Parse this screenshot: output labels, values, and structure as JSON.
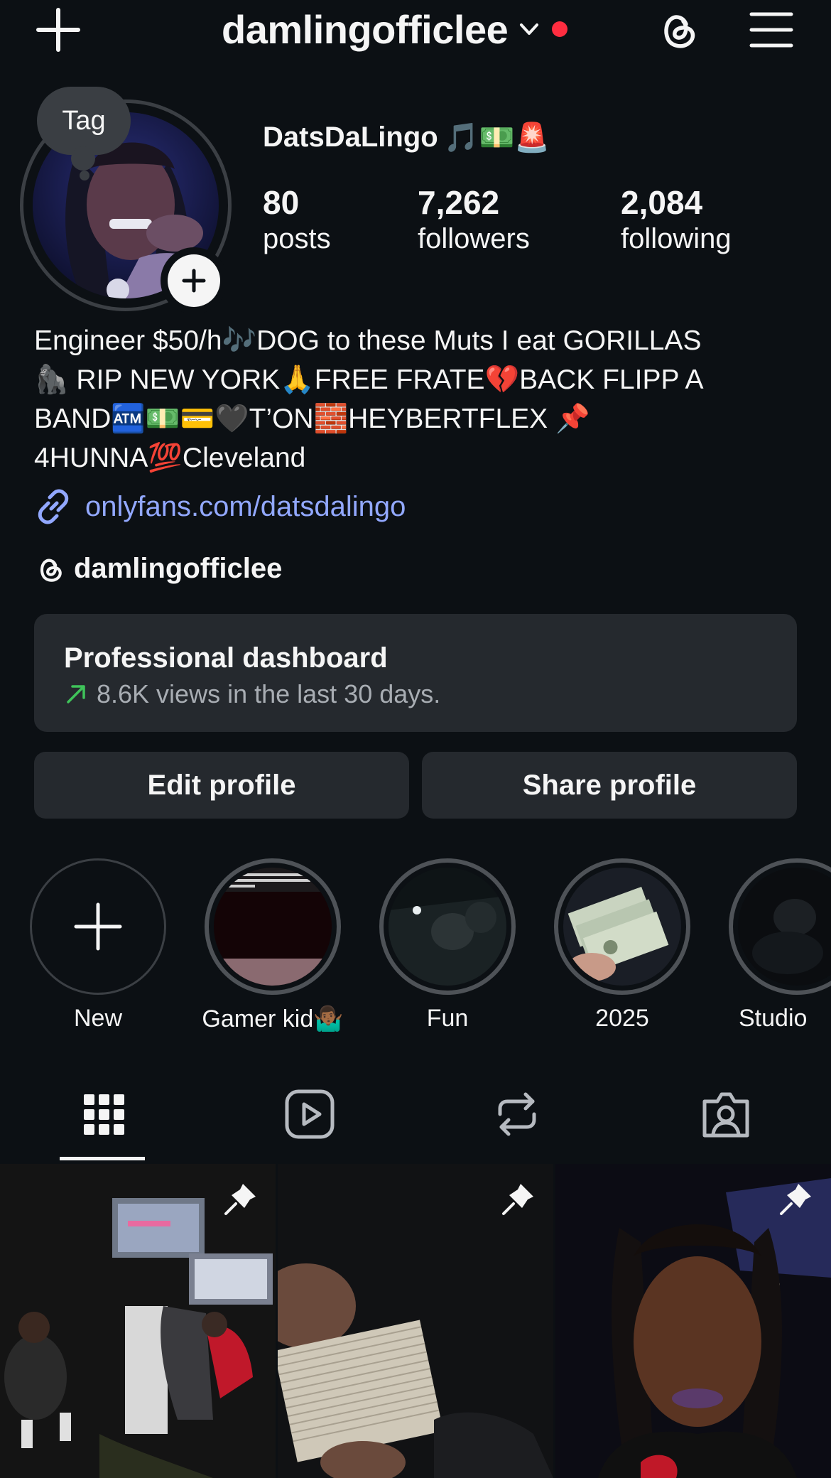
{
  "header": {
    "username": "damlingofficlee",
    "icons": [
      "plus-icon",
      "chevron-down-icon",
      "notification-dot",
      "threads-icon",
      "menu-icon"
    ]
  },
  "profile": {
    "tag_label": "Tag",
    "display_name": "DatsDaLingo",
    "display_name_emojis": "🎵💵🚨",
    "stats": [
      {
        "value": "80",
        "label": "posts"
      },
      {
        "value": "7,262",
        "label": "followers"
      },
      {
        "value": "2,084",
        "label": "following"
      }
    ]
  },
  "bio": {
    "text": "Engineer $50/h🎶DOG to these Muts I eat GORILLAS\n🦍 RIP NEW YORK🙏FREE FRATE💔BACK FLIPP A\nBAND🏧💵💳🖤T’ON🧱HEYBERTFLEX 📌\n4HUNNA💯Cleveland",
    "link": "onlyfans.com/datsdalingo",
    "threads_handle": "damlingofficlee"
  },
  "dashboard": {
    "title": "Professional dashboard",
    "subtitle": "8.6K views in the last 30 days.",
    "trend_color": "#3fc35a"
  },
  "buttons": {
    "edit": "Edit profile",
    "share": "Share profile"
  },
  "highlights": [
    {
      "label": "New"
    },
    {
      "label": "Gamer kid🤷🏾‍♂️"
    },
    {
      "label": "Fun"
    },
    {
      "label": "2025"
    },
    {
      "label": "Studio"
    }
  ],
  "tabs": [
    "grid-icon",
    "reels-icon",
    "reposts-icon",
    "tagged-icon"
  ],
  "colors": {
    "background": "#0c1014",
    "card": "#25292e",
    "link": "#92a8ff",
    "notification": "#ff2d40"
  }
}
